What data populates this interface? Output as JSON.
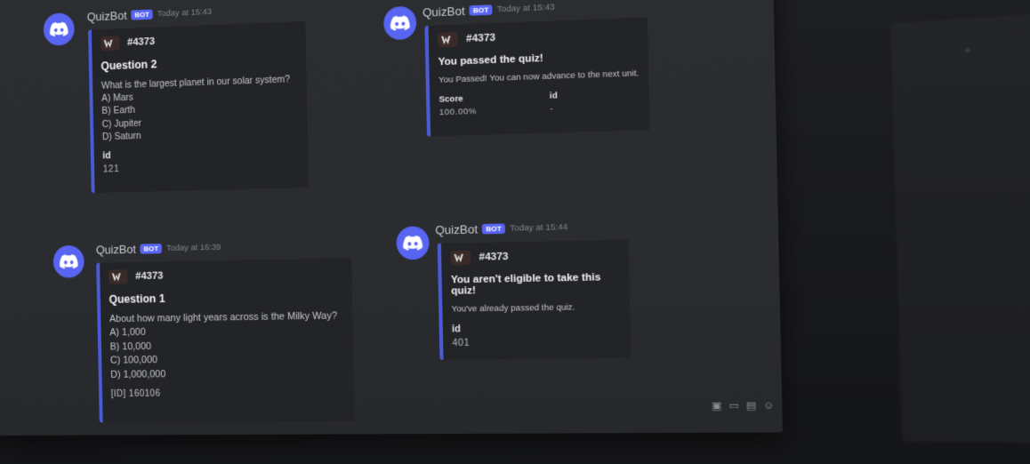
{
  "messages": [
    {
      "username": "QuizBot",
      "bot_tag": "BOT",
      "timestamp": "Today at 15:43",
      "embed": {
        "author": "#4373",
        "title": "Question 2",
        "description": [
          "What is the largest planet in our solar system?",
          "A) Mars",
          "B) Earth",
          "C) Jupiter",
          "D) Saturn"
        ],
        "field_name": "id",
        "field_value": "121"
      }
    },
    {
      "username": "QuizBot",
      "bot_tag": "BOT",
      "timestamp": "Today at 15:43",
      "embed": {
        "author": "#4373",
        "title": "You passed the quiz!",
        "description": "You Passed! You can now advance to the next unit.",
        "fields": [
          {
            "name": "Score",
            "value": "100.00%"
          },
          {
            "name": "id",
            "value": "-"
          }
        ]
      }
    },
    {
      "username": "QuizBot",
      "bot_tag": "BOT",
      "timestamp": "Today at 16:39",
      "embed": {
        "author": "#4373",
        "title": "Question 1",
        "description": [
          "About how many light years across is the Milky Way?",
          "A) 1,000",
          "B) 10,000",
          "C) 100,000",
          "D) 1,000,000"
        ],
        "footer_value": "[ID] 160106"
      }
    },
    {
      "username": "QuizBot",
      "bot_tag": "BOT",
      "timestamp": "Today at 15:44",
      "embed": {
        "author": "#4373",
        "title": "You aren't eligible to take this quiz!",
        "description": "You've already passed the quiz.",
        "field_name": "id",
        "field_value": "401"
      }
    }
  ],
  "icons": {
    "avatar": "discord-logo-icon",
    "toolbar": [
      "gift-icon",
      "gif-icon",
      "sticker-icon",
      "emoji-icon"
    ]
  },
  "colors": {
    "accent": "#5865f2",
    "embed_border": "#4b5bd6",
    "background": "#2b2d31"
  }
}
